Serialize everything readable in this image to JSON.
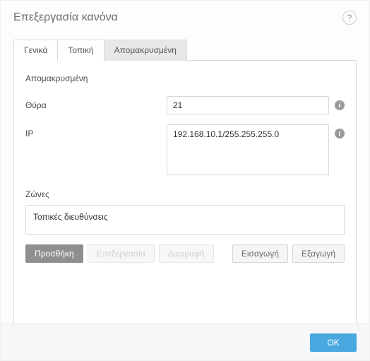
{
  "window": {
    "title": "Επεξεργασία κανόνα"
  },
  "tabs": {
    "general": "Γενικά",
    "local": "Τοπική",
    "remote": "Απομακρυσμένη",
    "active": "remote"
  },
  "remote": {
    "section_title": "Απομακρυσμένη",
    "port_label": "Θύρα",
    "port_value": "21",
    "ip_label": "IP",
    "ip_value": "192.168.10.1/255.255.255.0",
    "zones_label": "Ζώνες",
    "zones_items": [
      "Τοπικές διευθύνσεις"
    ]
  },
  "buttons": {
    "add": "Προσθήκη",
    "edit": "Επεξεργασία",
    "delete": "Διαγραφή",
    "import": "Εισαγωγή",
    "export": "Εξαγωγή",
    "ok": "OK"
  },
  "icons": {
    "help": "?",
    "info": "i"
  }
}
